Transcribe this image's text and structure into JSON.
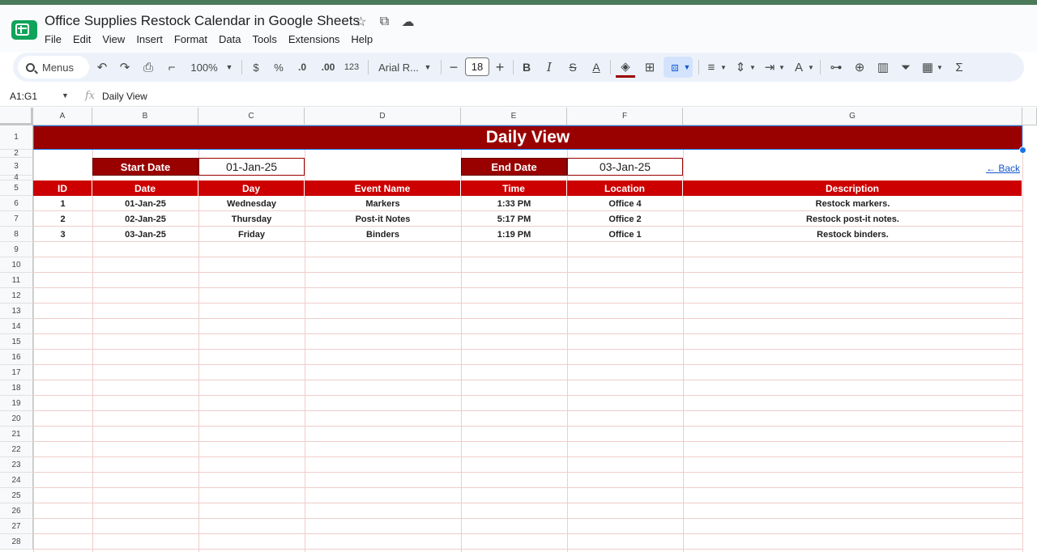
{
  "app": {
    "doc_title": "Office Supplies Restock Calendar in Google Sheets",
    "brand_color": "#10a35a",
    "menu": [
      "File",
      "Edit",
      "View",
      "Insert",
      "Format",
      "Data",
      "Tools",
      "Extensions",
      "Help"
    ]
  },
  "toolbar": {
    "search_label": "Menus",
    "zoom": "100%",
    "currency": "$",
    "percent": "%",
    "dec_decrease": ".0",
    "dec_increase": ".00",
    "number_format": "123",
    "font_name": "Arial R...",
    "font_size": "18"
  },
  "formula_bar": {
    "name_box": "A1:G1",
    "fx": "fx",
    "content": "Daily View"
  },
  "sheet": {
    "columns": [
      "A",
      "B",
      "C",
      "D",
      "E",
      "F",
      "G"
    ],
    "rows": [
      "1",
      "2",
      "3",
      "4",
      "5",
      "6",
      "7",
      "8",
      "9",
      "10",
      "11",
      "12",
      "13",
      "14",
      "15",
      "16",
      "17",
      "18",
      "19",
      "20",
      "21",
      "22",
      "23",
      "24",
      "25",
      "26",
      "27",
      "28"
    ],
    "banner_title": "Daily View",
    "start_date_label": "Start Date",
    "start_date_value": "01-Jan-25",
    "end_date_label": "End Date",
    "end_date_value": "03-Jan-25",
    "back_link": "← Back",
    "table_headers": [
      "ID",
      "Date",
      "Day",
      "Event Name",
      "Time",
      "Location",
      "Description"
    ],
    "table_rows": [
      [
        "1",
        "01-Jan-25",
        "Wednesday",
        "Markers",
        "1:33 PM",
        "Office 4",
        "Restock markers."
      ],
      [
        "2",
        "02-Jan-25",
        "Thursday",
        "Post-it Notes",
        "5:17 PM",
        "Office 2",
        "Restock post-it notes."
      ],
      [
        "3",
        "03-Jan-25",
        "Friday",
        "Binders",
        "1:19 PM",
        "Office 1",
        "Restock binders."
      ]
    ],
    "colors": {
      "banner": "#990000",
      "header": "#cc0000",
      "grid_line": "#f0cccc"
    }
  }
}
